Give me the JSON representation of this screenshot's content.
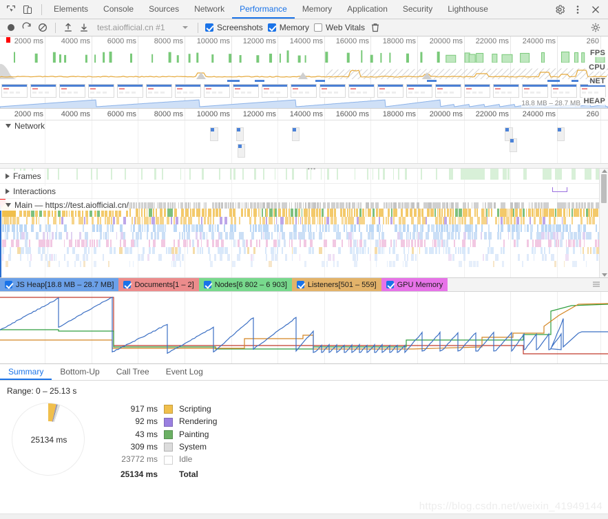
{
  "window": {
    "devtools_icons": [
      {
        "name": "inspect-element-icon",
        "glyph": "inspect"
      },
      {
        "name": "device-toolbar-icon",
        "glyph": "device"
      }
    ],
    "tabs": [
      {
        "label": "Elements",
        "active": false
      },
      {
        "label": "Console",
        "active": false
      },
      {
        "label": "Sources",
        "active": false
      },
      {
        "label": "Network",
        "active": false
      },
      {
        "label": "Performance",
        "active": true
      },
      {
        "label": "Memory",
        "active": false
      },
      {
        "label": "Application",
        "active": false
      },
      {
        "label": "Security",
        "active": false
      },
      {
        "label": "Lighthouse",
        "active": false
      }
    ],
    "right_icons": [
      {
        "name": "settings-gear-icon"
      },
      {
        "name": "more-options-icon"
      },
      {
        "name": "close-icon"
      }
    ]
  },
  "controls": {
    "record_label": "Record",
    "reload_label": "Start profiling and reload page",
    "clear_label": "Clear",
    "load_label": "Load profile",
    "save_label": "Save profile",
    "profile_select": "test.aiofficial.cn #1",
    "checkboxes": [
      {
        "label": "Screenshots",
        "checked": true
      },
      {
        "label": "Memory",
        "checked": true
      },
      {
        "label": "Web Vitals",
        "checked": false
      }
    ],
    "trash_label": "Collect garbage",
    "settings_label": "Capture settings"
  },
  "overview": {
    "row_labels": [
      "FPS",
      "CPU",
      "NET",
      "HEAP"
    ],
    "ticks": [
      "2000 ms",
      "4000 ms",
      "6000 ms",
      "8000 ms",
      "10000 ms",
      "12000 ms",
      "14000 ms",
      "16000 ms",
      "18000 ms",
      "20000 ms",
      "22000 ms",
      "24000 ms",
      "260"
    ],
    "heap_range": "18.8 MB – 28.7 MB"
  },
  "timeline": {
    "ticks": [
      "2000 ms",
      "4000 ms",
      "6000 ms",
      "8000 ms",
      "10000 ms",
      "12000 ms",
      "14000 ms",
      "16000 ms",
      "18000 ms",
      "20000 ms",
      "22000 ms",
      "24000 ms",
      "260"
    ]
  },
  "tracks": [
    {
      "name": "network",
      "label": "Network",
      "expanded": true
    },
    {
      "name": "frames",
      "label": "Frames",
      "expanded": false
    },
    {
      "name": "interactions",
      "label": "Interactions",
      "expanded": false
    },
    {
      "name": "main",
      "label": "Main — https://test.aiofficial.cn/",
      "expanded": true
    }
  ],
  "memory_legend": [
    {
      "label": "JS Heap[18.8 MB – 28.7 MB]",
      "checked": true,
      "color": "#6ba0e8"
    },
    {
      "label": "Documents[1 – 2]",
      "checked": true,
      "color": "#ec8c8c"
    },
    {
      "label": "Nodes[6 802 – 6 903]",
      "checked": true,
      "color": "#78d98d"
    },
    {
      "label": "Listeners[501 – 559]",
      "checked": true,
      "color": "#e3b36a"
    },
    {
      "label": "GPU Memory",
      "checked": true,
      "color": "#e773e8"
    }
  ],
  "drawer": {
    "tabs": [
      {
        "label": "Summary",
        "active": true
      },
      {
        "label": "Bottom-Up",
        "active": false
      },
      {
        "label": "Call Tree",
        "active": false
      },
      {
        "label": "Event Log",
        "active": false
      }
    ],
    "range_text": "Range: 0 – 25.13 s",
    "donut_center": "25134 ms"
  },
  "chart_data": {
    "type": "pie",
    "title": "Activity summary",
    "categories": [
      "Scripting",
      "Rendering",
      "Painting",
      "System",
      "Idle"
    ],
    "values": [
      917,
      92,
      43,
      309,
      23772
    ],
    "value_labels": [
      "917 ms",
      "92 ms",
      "43 ms",
      "309 ms",
      "23772 ms"
    ],
    "colors": [
      "#f0bf4c",
      "#9a7fe0",
      "#6bb064",
      "#dcdcdc",
      "#ffffff"
    ],
    "total_label": "Total",
    "total_value": 25134,
    "total_value_label": "25134 ms",
    "unit": "ms",
    "legend_position": "right"
  },
  "watermark": "https://blog.csdn.net/weixin_41949144"
}
